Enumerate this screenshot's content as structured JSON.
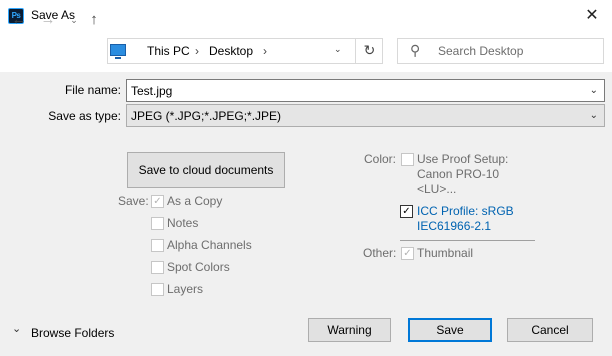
{
  "window": {
    "title": "Save As",
    "app_icon_text": "Ps",
    "close_glyph": "✕"
  },
  "nav": {
    "back_glyph": "←",
    "forward_glyph": "→",
    "recent_glyph": "⌄",
    "up_glyph": "↑",
    "breadcrumb": [
      "This PC",
      "Desktop"
    ],
    "separator": "›",
    "address_dropdown_glyph": "⌄",
    "refresh_glyph": "↻",
    "search_placeholder": "Search Desktop",
    "search_glyph": "⚲"
  },
  "form": {
    "file_name_label": "File name:",
    "file_name_value": "Test.jpg",
    "save_type_label": "Save as type:",
    "save_type_value": "JPEG (*.JPG;*.JPEG;*.JPE)",
    "dropdown_glyph": "⌄"
  },
  "cloud_button": "Save to cloud documents",
  "save_options": {
    "label": "Save:",
    "items": [
      {
        "label": "As a Copy",
        "checked": true,
        "disabled": true
      },
      {
        "label": "Notes",
        "checked": false,
        "disabled": true
      },
      {
        "label": "Alpha Channels",
        "checked": false,
        "disabled": true
      },
      {
        "label": "Spot Colors",
        "checked": false,
        "disabled": true
      },
      {
        "label": "Layers",
        "checked": false,
        "disabled": true
      }
    ]
  },
  "color": {
    "label": "Color:",
    "proof_line1": "Use Proof Setup:",
    "proof_line2": "Canon PRO-10",
    "proof_line3": "<LU>...",
    "icc_line1": "ICC Profile:  sRGB",
    "icc_line2": "IEC61966-2.1",
    "icc_checked": true
  },
  "other": {
    "label": "Other:",
    "thumbnail_label": "Thumbnail",
    "thumbnail_checked": true
  },
  "footer": {
    "browse_glyph": "⌄",
    "browse_label": "Browse Folders",
    "warning_button": "Warning",
    "save_button": "Save",
    "cancel_button": "Cancel"
  },
  "check_glyph": "✓",
  "colors": {
    "accent": "#0078d7",
    "link": "#0063b1",
    "app_icon_bg": "#0b1d33",
    "app_icon_fg": "#31a8ff"
  }
}
